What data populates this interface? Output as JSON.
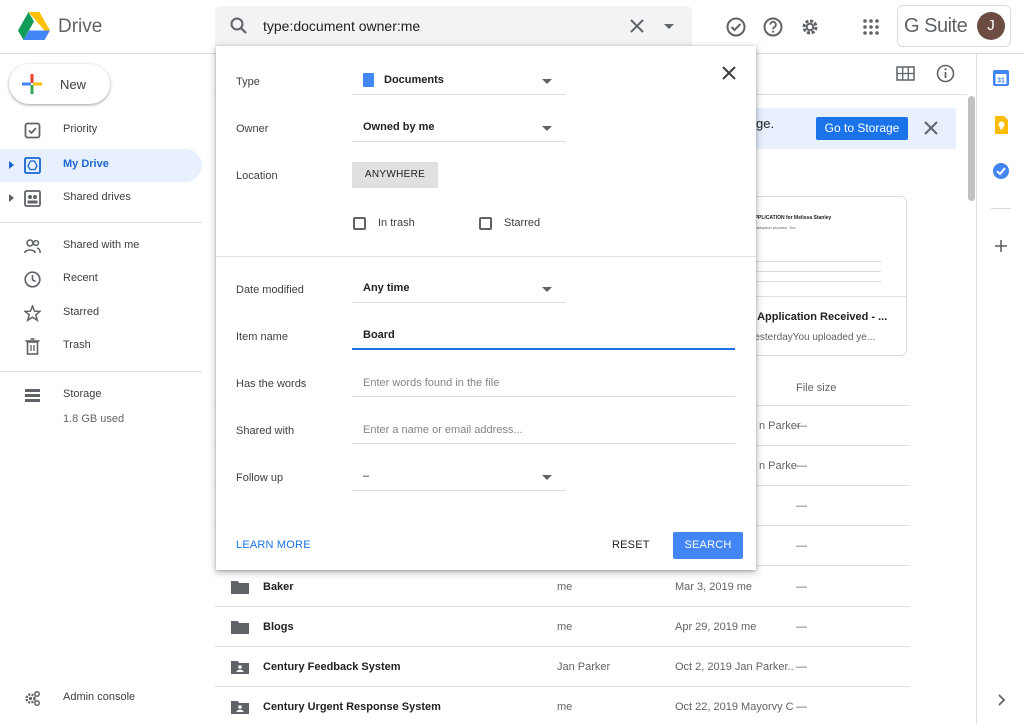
{
  "app": {
    "name": "Drive"
  },
  "search": {
    "query": "type:document owner:me"
  },
  "header": {
    "gsuite_label": "G Suite",
    "avatar_initial": "J"
  },
  "sidebar": {
    "new_label": "New",
    "items": [
      {
        "label": "Priority",
        "icon": "priority-icon"
      },
      {
        "label": "My Drive",
        "icon": "my-drive-icon"
      },
      {
        "label": "Shared drives",
        "icon": "shared-drives-icon"
      },
      {
        "label": "Shared with me",
        "icon": "shared-with-me-icon"
      },
      {
        "label": "Recent",
        "icon": "clock-icon"
      },
      {
        "label": "Starred",
        "icon": "star-icon"
      },
      {
        "label": "Trash",
        "icon": "trash-icon"
      },
      {
        "label": "Storage",
        "icon": "storage-icon"
      }
    ],
    "storage_used": "1.8 GB used",
    "admin_label": "Admin console"
  },
  "banner": {
    "text_fragment": "ge.",
    "button_label": "Go to Storage"
  },
  "card": {
    "preview_heading": "ION APPLICATION for Melissa Stanley",
    "preview_line": "hMRDR adoption process. Yes",
    "title_fragment": "on Application Received - ...",
    "subtitle_fragment": "d yesterdayYou uploaded ye..."
  },
  "file_list": {
    "size_header": "File size",
    "partial_rows": [
      {
        "text": "n Parker",
        "size": "—"
      },
      {
        "text": "n Parke",
        "size": "—"
      },
      {
        "text": "",
        "size": "—"
      },
      {
        "text": "",
        "size": "—"
      }
    ],
    "rows": [
      {
        "name": "Baker",
        "owner": "me",
        "modified": "Mar 3, 2019  me",
        "size": "—",
        "icon": "folder-icon"
      },
      {
        "name": "Blogs",
        "owner": "me",
        "modified": "Apr 29, 2019  me",
        "size": "—",
        "icon": "folder-icon"
      },
      {
        "name": "Century Feedback System",
        "owner": "Jan Parker",
        "modified": "Oct 2, 2019  Jan Parker..",
        "size": "—",
        "icon": "shared-folder-icon"
      },
      {
        "name": "Century Urgent Response System",
        "owner": "me",
        "modified": "Oct 22, 2019  Mayorvy C",
        "size": "—",
        "icon": "shared-folder-icon"
      }
    ]
  },
  "advanced_search": {
    "type_label": "Type",
    "type_value": "Documents",
    "owner_label": "Owner",
    "owner_value": "Owned by me",
    "location_label": "Location",
    "location_value": "ANYWHERE",
    "in_trash_label": "In trash",
    "starred_label": "Starred",
    "date_label": "Date modified",
    "date_value": "Any time",
    "item_name_label": "Item name",
    "item_name_value": "Board",
    "words_label": "Has the words",
    "words_placeholder": "Enter words found in the file",
    "shared_label": "Shared with",
    "shared_placeholder": "Enter a name or email address...",
    "follow_label": "Follow up",
    "follow_value": "–",
    "learn_more": "LEARN MORE",
    "reset": "RESET",
    "search": "SEARCH"
  },
  "colors": {
    "accent": "#1a73e8",
    "active_bg": "#e8f0fe",
    "search_button": "#4285f4"
  }
}
